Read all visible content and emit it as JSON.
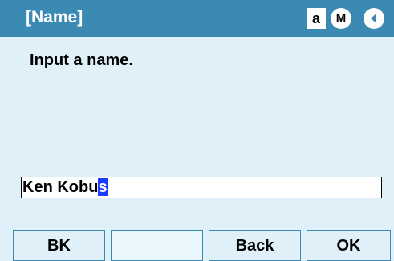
{
  "header": {
    "title": "[Name]",
    "mode_char": "a",
    "mode_badge": "M",
    "nav_icon": "left-arrow-icon"
  },
  "main": {
    "prompt": "Input a name.",
    "input": {
      "text_before_cursor": "Ken Kobu",
      "cursor_char": "s"
    }
  },
  "softkeys": [
    {
      "label": "BK"
    },
    {
      "label": ""
    },
    {
      "label": "Back"
    },
    {
      "label": "OK"
    }
  ],
  "colors": {
    "header_bg": "#3a8ab4",
    "screen_bg": "#dff0f9",
    "cursor_bg": "#1a3cff"
  }
}
